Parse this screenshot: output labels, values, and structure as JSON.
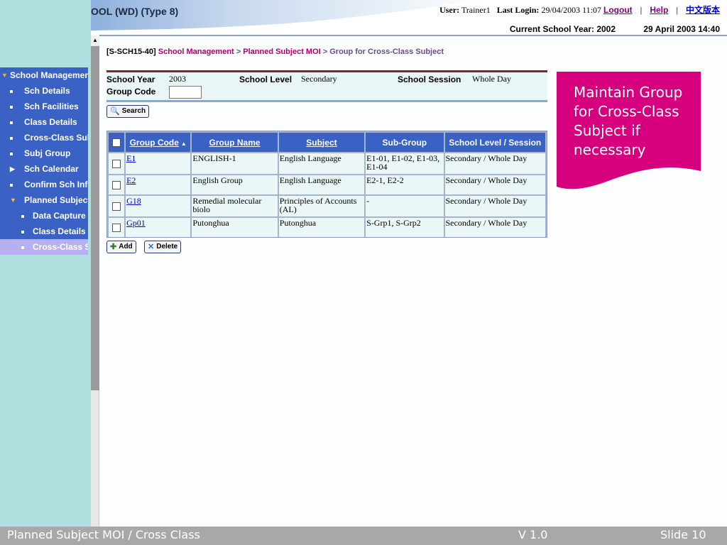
{
  "header": {
    "school_title": "OOL (WD) (Type 8)",
    "user_label": "User:",
    "user_value": "Trainer1",
    "last_login_label": "Last Login:",
    "last_login_value": "29/04/2003 11:07",
    "logout_label": "Logout",
    "help_label": "Help",
    "chinese_label": "中文版本",
    "current_school_year": "Current School Year: 2002",
    "datetime": "29 April 2003 14:40"
  },
  "sidebar": {
    "items": [
      {
        "label": "School Management",
        "icon": "triangle-down-icon"
      },
      {
        "label": "Sch Details",
        "icon": "square-bullet-icon"
      },
      {
        "label": "Sch Facilities",
        "icon": "square-bullet-icon"
      },
      {
        "label": "Class Details",
        "icon": "square-bullet-icon"
      },
      {
        "label": "Cross-Class Subject",
        "icon": "square-bullet-icon"
      },
      {
        "label": "Subj Group",
        "icon": "square-bullet-icon"
      },
      {
        "label": "Sch Calendar",
        "icon": "triangle-right-icon"
      },
      {
        "label": "Confirm Sch Info",
        "icon": "square-bullet-icon"
      },
      {
        "label": "Planned Subject MOI",
        "icon": "triangle-down-icon"
      },
      {
        "label": "Data Capture",
        "icon": "square-bullet-icon"
      },
      {
        "label": "Class Details",
        "icon": "square-bullet-icon"
      },
      {
        "label": "Cross-Class Subject",
        "icon": "square-bullet-icon"
      }
    ]
  },
  "breadcrumb": {
    "code": "[S-SCH15-40]",
    "link1": "School Management",
    "sep": ">",
    "link2": "Planned Subject MOI",
    "current": "Group for Cross-Class Subject"
  },
  "criteria": {
    "school_year_label": "School Year",
    "school_year_value": "2003",
    "school_level_label": "School Level",
    "school_level_value": "Secondary",
    "school_session_label": "School Session",
    "school_session_value": "Whole Day",
    "group_code_label": "Group Code",
    "group_code_value": ""
  },
  "buttons": {
    "search": "Search",
    "add": "Add",
    "delete": "Delete"
  },
  "table": {
    "headers": [
      "Group Code",
      "Group Name",
      "Subject",
      "Sub-Group",
      "School Level / Session"
    ],
    "sort_icon": "sort-ascending-icon",
    "rows": [
      {
        "code": "E1",
        "name": "ENGLISH-1",
        "subject": "English Language",
        "subgroup": "E1-01, E1-02, E1-03, E1-04",
        "level": "Secondary / Whole Day"
      },
      {
        "code": "E2",
        "name": "English Group",
        "subject": "English Language",
        "subgroup": "E2-1, E2-2",
        "level": "Secondary / Whole Day"
      },
      {
        "code": "G18",
        "name": "Remedial molecular biolo",
        "subject": "Principles of Accounts (AL)",
        "subgroup": "-",
        "level": "Secondary / Whole Day"
      },
      {
        "code": "Gp01",
        "name": "Putonghua",
        "subject": "Putonghua",
        "subgroup": "S-Grp1, S-Grp2",
        "level": "Secondary / Whole Day"
      }
    ]
  },
  "callout": {
    "text": "Maintain Group for Cross-Class Subject if necessary",
    "color": "#d6007e"
  },
  "footer": {
    "title": "Planned Subject MOI / Cross Class",
    "version": "V 1.0",
    "slide": "Slide 10"
  }
}
